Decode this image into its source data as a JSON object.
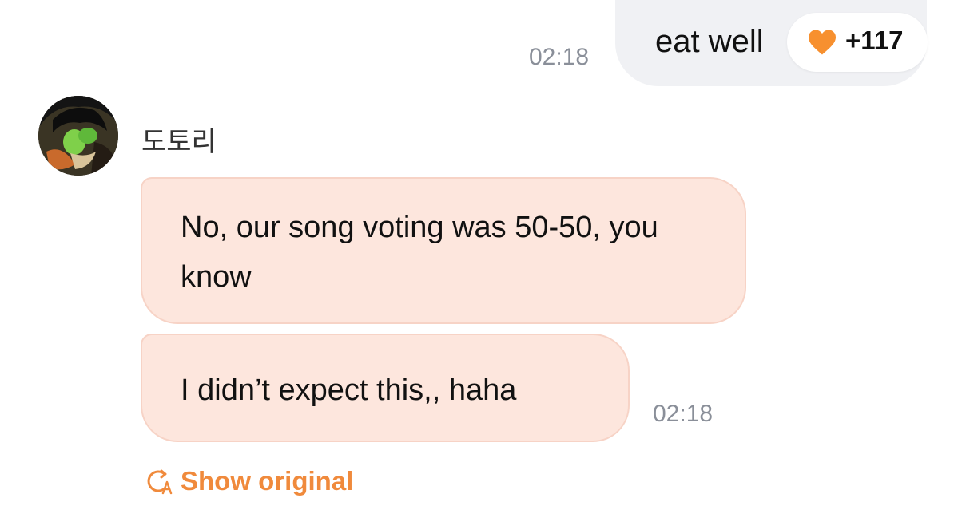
{
  "sent_message": {
    "text": "eat well",
    "time": "02:18",
    "reaction": {
      "icon": "heart-icon",
      "count": "+117",
      "color": "#f7902f"
    }
  },
  "received": {
    "sender_name": "도토리",
    "messages": [
      {
        "text": "No, our song voting was 50-50, you know"
      },
      {
        "text": "I didn’t expect this,, haha"
      }
    ],
    "time": "02:18"
  },
  "translation": {
    "icon": "translate-icon",
    "label": "Show original",
    "color": "#f08a3c"
  },
  "colors": {
    "received_bubble": "#fde6dd",
    "sent_bubble": "#f0f1f4",
    "timestamp": "#8a8f99"
  }
}
